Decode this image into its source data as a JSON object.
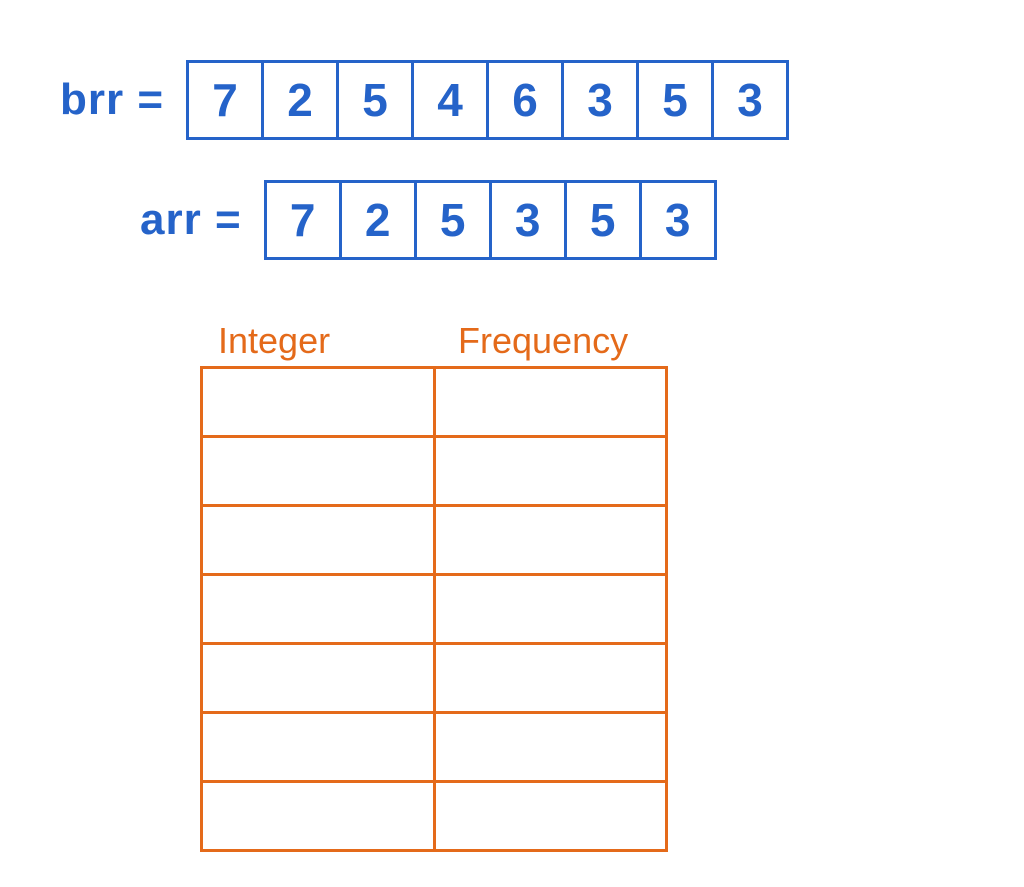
{
  "brr": {
    "label": "brr =",
    "values": [
      "7",
      "2",
      "5",
      "4",
      "6",
      "3",
      "5",
      "3"
    ]
  },
  "arr": {
    "label": "arr =",
    "values": [
      "7",
      "2",
      "5",
      "3",
      "5",
      "3"
    ]
  },
  "frequency_table": {
    "headers": {
      "integer": "Integer",
      "frequency": "Frequency"
    },
    "rows": [
      {
        "integer": "",
        "frequency": ""
      },
      {
        "integer": "",
        "frequency": ""
      },
      {
        "integer": "",
        "frequency": ""
      },
      {
        "integer": "",
        "frequency": ""
      },
      {
        "integer": "",
        "frequency": ""
      },
      {
        "integer": "",
        "frequency": ""
      },
      {
        "integer": "",
        "frequency": ""
      }
    ]
  }
}
